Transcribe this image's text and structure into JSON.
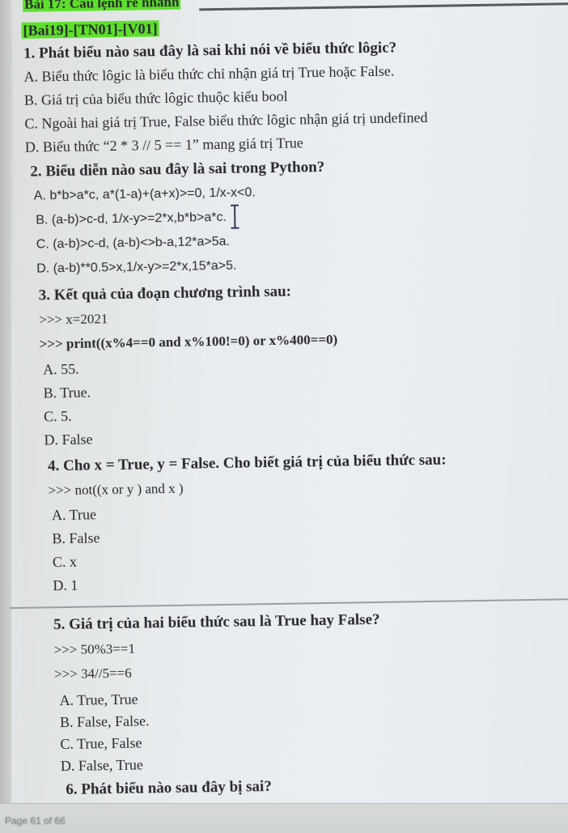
{
  "document": {
    "cut_heading": "Bài 17: Câu lệnh rẽ nhánh",
    "tag": "[Bai19]-[TN01]-[V01]",
    "highlight_color": "#5de02a"
  },
  "questions": [
    {
      "title": "1. Phát biểu nào sau đây là sai khi nói về biểu thức lôgic?",
      "options": [
        "A. Biểu thức lôgic là biểu thức chỉ nhận giá trị True hoặc False.",
        "B. Giá trị của biểu thức lôgic thuộc kiểu bool",
        "C. Ngoài hai giá trị True, False biểu thức lôgic nhận giá trị undefined",
        "D. Biểu thức “2 * 3 // 5 == 1” mang giá trị True"
      ]
    },
    {
      "title": "2. Biểu diễn nào sau đây là sai trong Python?",
      "options": [
        "A. b*b>a*c, a*(1-a)+(a+x)>=0, 1/x-x<0.",
        "B. (a-b)>c-d, 1/x-y>=2*x,b*b>a*c.",
        "C. (a-b)>c-d, (a-b)<>b-a,12*a>5a.",
        "D. (a-b)**0.5>x,1/x-y>=2*x,15*a>5."
      ]
    },
    {
      "title": "3. Kết quả của đoạn chương trình sau:",
      "code": [
        ">>> x=2021",
        ">>> print((x%4==0 and x%100!=0) or x%400==0)"
      ],
      "options": [
        "A. 55.",
        "B. True.",
        "C. 5.",
        "D. False"
      ]
    },
    {
      "title": "4. Cho x = True, y = False. Cho biết giá trị của biểu thức sau:",
      "code": [
        ">>> not((x or y ) and x )"
      ],
      "options": [
        "A. True",
        "B. False",
        "C. x",
        "D. 1"
      ]
    },
    {
      "title": "5. Giá trị của hai biểu thức sau là True hay False?",
      "code": [
        ">>> 50%3==1",
        ">>> 34//5==6"
      ],
      "options": [
        "A. True, True",
        "B. False, False.",
        "C. True, False",
        "D. False, True"
      ]
    },
    {
      "title": "6. Phát biểu nào sau đây bị sai?"
    }
  ],
  "status_bar": {
    "page_info": "Page 61 of 66"
  }
}
